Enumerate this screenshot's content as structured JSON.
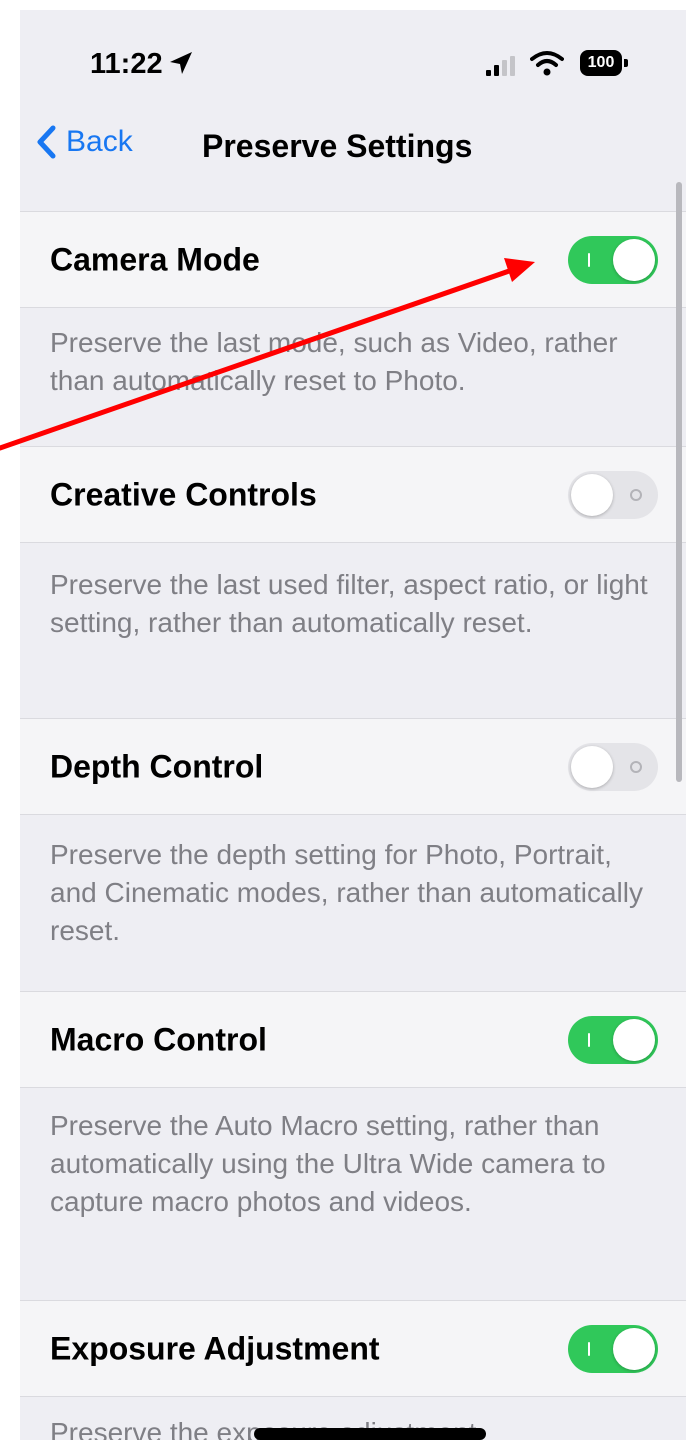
{
  "status_bar": {
    "time": "11:22",
    "battery": "100",
    "icons": [
      "location-arrow-icon",
      "cellular-signal-icon",
      "wifi-icon",
      "battery-icon"
    ]
  },
  "nav": {
    "back_label": "Back",
    "title": "Preserve Settings",
    "accent_color": "#1877f2"
  },
  "settings": [
    {
      "label": "Camera Mode",
      "enabled": true,
      "description": "Preserve the last mode, such as Video, rather than automatically reset to Photo."
    },
    {
      "label": "Creative Controls",
      "enabled": false,
      "description": "Preserve the last used filter, aspect ratio, or light setting, rather than automatically reset."
    },
    {
      "label": "Depth Control",
      "enabled": false,
      "description": "Preserve the depth setting for Photo, Portrait, and Cinematic modes, rather than automatically reset."
    },
    {
      "label": "Macro Control",
      "enabled": true,
      "description": "Preserve the Auto Macro setting, rather than automatically using the Ultra Wide camera to capture macro photos and videos."
    },
    {
      "label": "Exposure Adjustment",
      "enabled": true,
      "description": "Preserve the exposure adjustment"
    }
  ],
  "colors": {
    "toggle_on": "#30c85a",
    "toggle_off": "#e4e4e8",
    "annotation_arrow": "#ff0000"
  }
}
